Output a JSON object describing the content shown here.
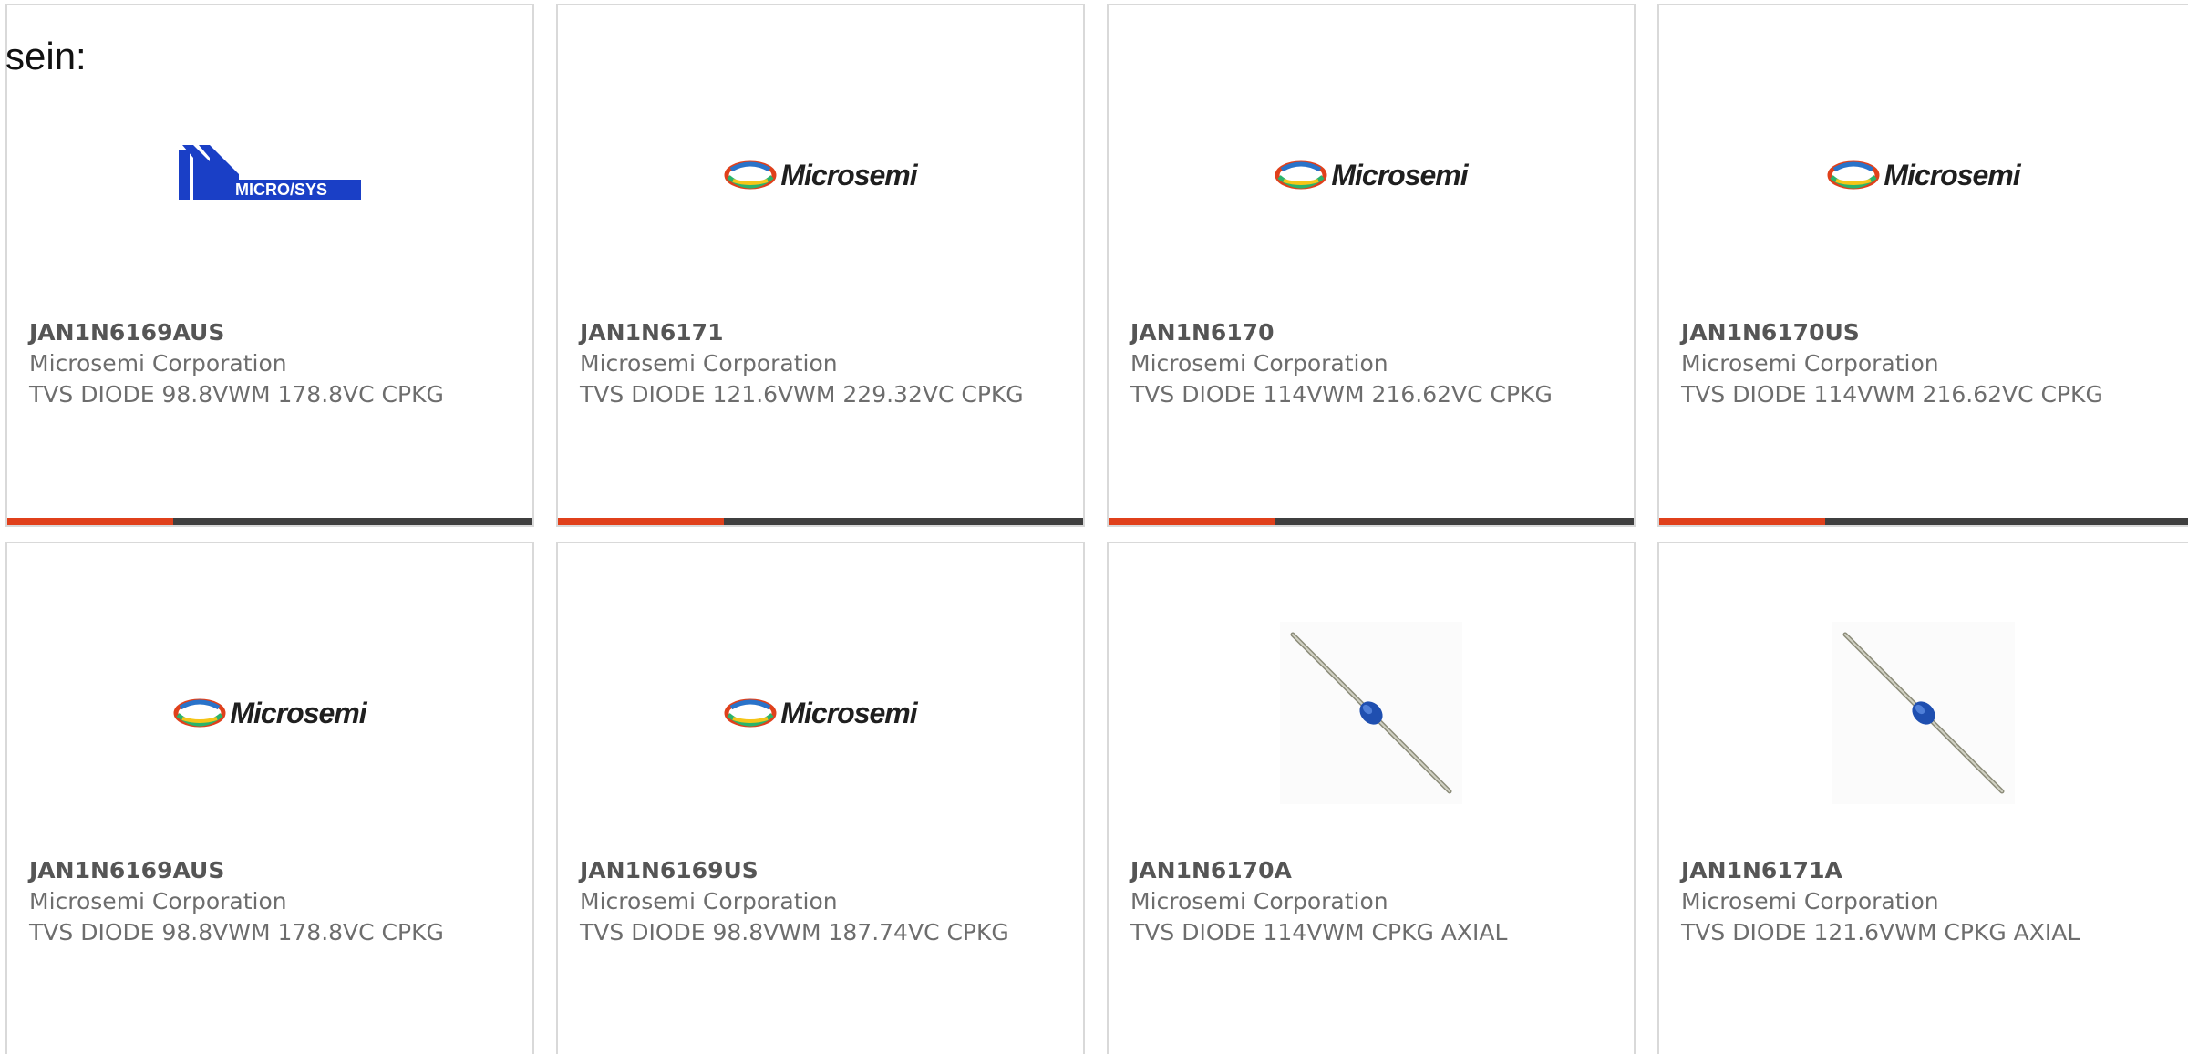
{
  "intro_text": "sein:",
  "colors": {
    "accent": "#e0401b",
    "bar": "#3f3f3f",
    "border": "#d9d9d9",
    "text": "#6d6d6d",
    "microsys_blue": "#1a3fc6"
  },
  "products": [
    {
      "part_number": "JAN1N6169AUS",
      "manufacturer": "Microsemi Corporation",
      "description": "TVS DIODE 98.8VWM 178.8VC CPKG",
      "image": "microsys-logo",
      "logo_text": "MICRO/SYS"
    },
    {
      "part_number": "JAN1N6171",
      "manufacturer": "Microsemi Corporation",
      "description": "TVS DIODE 121.6VWM 229.32VC CPKG",
      "image": "microsemi-logo",
      "logo_text": "Microsemi"
    },
    {
      "part_number": "JAN1N6170",
      "manufacturer": "Microsemi Corporation",
      "description": "TVS DIODE 114VWM 216.62VC CPKG",
      "image": "microsemi-logo",
      "logo_text": "Microsemi"
    },
    {
      "part_number": "JAN1N6170US",
      "manufacturer": "Microsemi Corporation",
      "description": "TVS DIODE 114VWM 216.62VC CPKG",
      "image": "microsemi-logo",
      "logo_text": "Microsemi"
    },
    {
      "part_number": "JAN1N6169AUS",
      "manufacturer": "Microsemi Corporation",
      "description": "TVS DIODE 98.8VWM 178.8VC CPKG",
      "image": "microsemi-logo",
      "logo_text": "Microsemi"
    },
    {
      "part_number": "JAN1N6169US",
      "manufacturer": "Microsemi Corporation",
      "description": "TVS DIODE 98.8VWM 187.74VC CPKG",
      "image": "microsemi-logo",
      "logo_text": "Microsemi"
    },
    {
      "part_number": "JAN1N6170A",
      "manufacturer": "Microsemi Corporation",
      "description": "TVS DIODE 114VWM CPKG AXIAL",
      "image": "axial-diode-photo",
      "logo_text": ""
    },
    {
      "part_number": "JAN1N6171A",
      "manufacturer": "Microsemi Corporation",
      "description": "TVS DIODE 121.6VWM CPKG AXIAL",
      "image": "axial-diode-photo",
      "logo_text": ""
    }
  ]
}
